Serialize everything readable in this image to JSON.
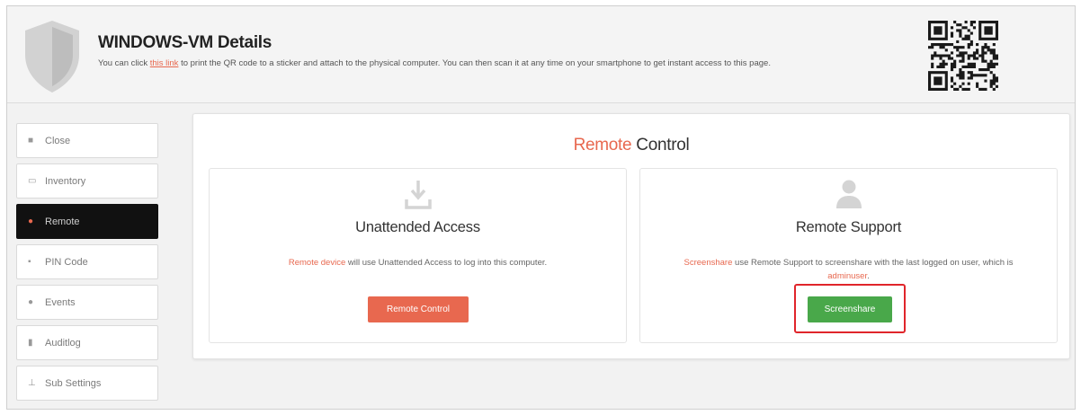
{
  "header": {
    "title": "WINDOWS-VM Details",
    "subtitle_before": "You can click ",
    "subtitle_link": "this link",
    "subtitle_after": " to print the QR code to a sticker and attach to the physical computer. You can then scan it at any time on your smartphone to get instant access to this page."
  },
  "sidebar": {
    "items": [
      {
        "label": "Close",
        "icon": "square-icon"
      },
      {
        "label": "Inventory",
        "icon": "laptop-icon"
      },
      {
        "label": "Remote",
        "icon": "remote-icon"
      },
      {
        "label": "PIN Code",
        "icon": "lock-icon"
      },
      {
        "label": "Events",
        "icon": "info-icon"
      },
      {
        "label": "Auditlog",
        "icon": "file-icon"
      },
      {
        "label": "Sub Settings",
        "icon": "sitemap-icon"
      }
    ]
  },
  "main": {
    "title_accent": "Remote",
    "title_rest": " Control",
    "cards": [
      {
        "icon": "download-icon",
        "title": "Unattended Access",
        "text_accent": "Remote device",
        "text_rest": " will use Unattended Access to log into this computer.",
        "button": "Remote Control"
      },
      {
        "icon": "user-icon",
        "title": "Remote Support",
        "text_accent": "Screenshare",
        "text_rest": " use Remote Support to screenshare with the last logged on user, which is ",
        "text_user": "adminuser",
        "text_end": ".",
        "button": "Screenshare"
      }
    ]
  },
  "colors": {
    "accent": "#e8684f",
    "success": "#49a84a",
    "highlight": "#e0252b",
    "active_bg": "#111111"
  }
}
